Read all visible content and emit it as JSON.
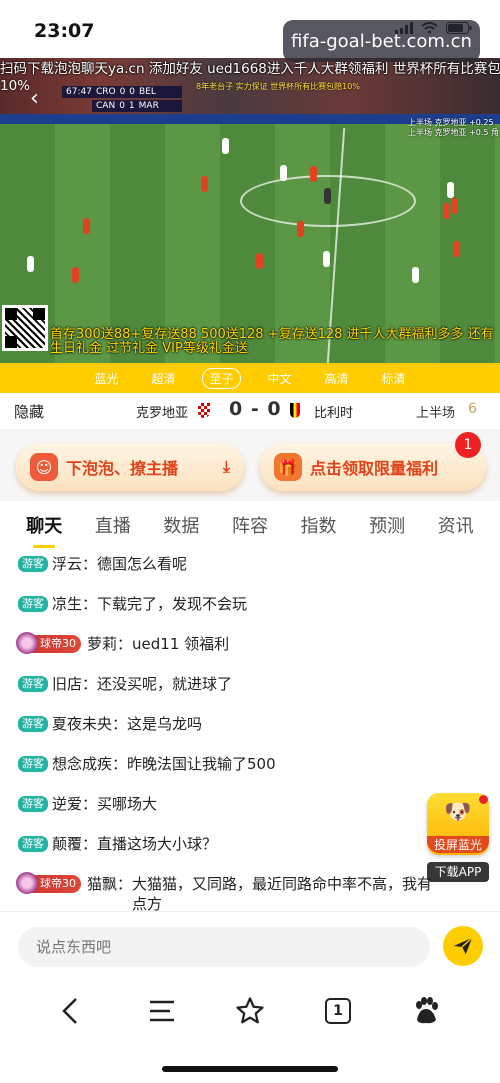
{
  "status_bar": {
    "time": "23:07"
  },
  "watermark": "fifa-goal-bet.com.cn",
  "video": {
    "marquee_line1": "扫码下载泡泡聊天ya.cn 添加好友 ued1668进入千人大群领福利 世界杯所有比赛包赔",
    "marquee_line2": "10%",
    "scorebug": {
      "time": "67:47",
      "home": "CRO",
      "home_score": "0",
      "away_score": "0",
      "away": "BEL",
      "home2": "CAN",
      "home2_score": "0",
      "away2_score": "1",
      "away2": "MAR"
    },
    "overlay_yellow_1": "8年老台子 实力保证  世界杯所有比赛包赔10%",
    "overlay_right_1": "上半场 克罗地亚 +0.25",
    "overlay_right_2": "上半场 克罗地亚 +0.5 角",
    "promo_bottom": "首存300送88+复存送88  500送128 +复存送128  进千人大群福利多多 还有生日礼金 过节礼金 VIP等级礼金送"
  },
  "quality_bar": {
    "items": [
      "蓝光",
      "超清",
      "至子",
      "中文",
      "高清",
      "标清"
    ],
    "active_index": 2
  },
  "match": {
    "hide_label": "隐藏",
    "home_team": "克罗地亚",
    "score": "0 - 0",
    "away_team": "比利时",
    "period": "上半场",
    "period_num": "6"
  },
  "promos": {
    "left_label": "下泡泡、撩主播",
    "right_label": "点击领取限量福利",
    "badge_count": "1"
  },
  "tabs": [
    "聊天",
    "直播",
    "数据",
    "阵容",
    "指数",
    "预测",
    "资讯"
  ],
  "chat": [
    {
      "tag": "游客",
      "vip": false,
      "nick": "浮云：",
      "text": "德国怎么看呢"
    },
    {
      "tag": "游客",
      "vip": false,
      "nick": "凉生：",
      "text": "下载完了，发现不会玩"
    },
    {
      "tag": "球帝30",
      "vip": true,
      "nick": "萝莉：",
      "text": "ued11 领福利"
    },
    {
      "tag": "游客",
      "vip": false,
      "nick": "旧店：",
      "text": "还没买呢，就进球了"
    },
    {
      "tag": "游客",
      "vip": false,
      "nick": "夏夜未央：",
      "text": "这是乌龙吗"
    },
    {
      "tag": "游客",
      "vip": false,
      "nick": "想念成疾：",
      "text": "昨晚法国让我输了500"
    },
    {
      "tag": "游客",
      "vip": false,
      "nick": "逆爱：",
      "text": "买哪场大"
    },
    {
      "tag": "游客",
      "vip": false,
      "nick": "颠覆：",
      "text": "直播这场大小球？"
    },
    {
      "tag": "球帝30",
      "vip": true,
      "nick": "猫飘：",
      "text": "大猫猫，又同路，最近同路命中率不高，我有点方"
    }
  ],
  "cast": {
    "label": "投屏蓝光",
    "download": "下载APP"
  },
  "input": {
    "placeholder": "说点东西吧"
  },
  "bottom_nav": {
    "tab_count": "1"
  },
  "colors": {
    "accent": "#ffcc00",
    "promo_text": "#e0421a",
    "guest_tag": "#22b3a3",
    "vip_tag": "#d63c32"
  }
}
